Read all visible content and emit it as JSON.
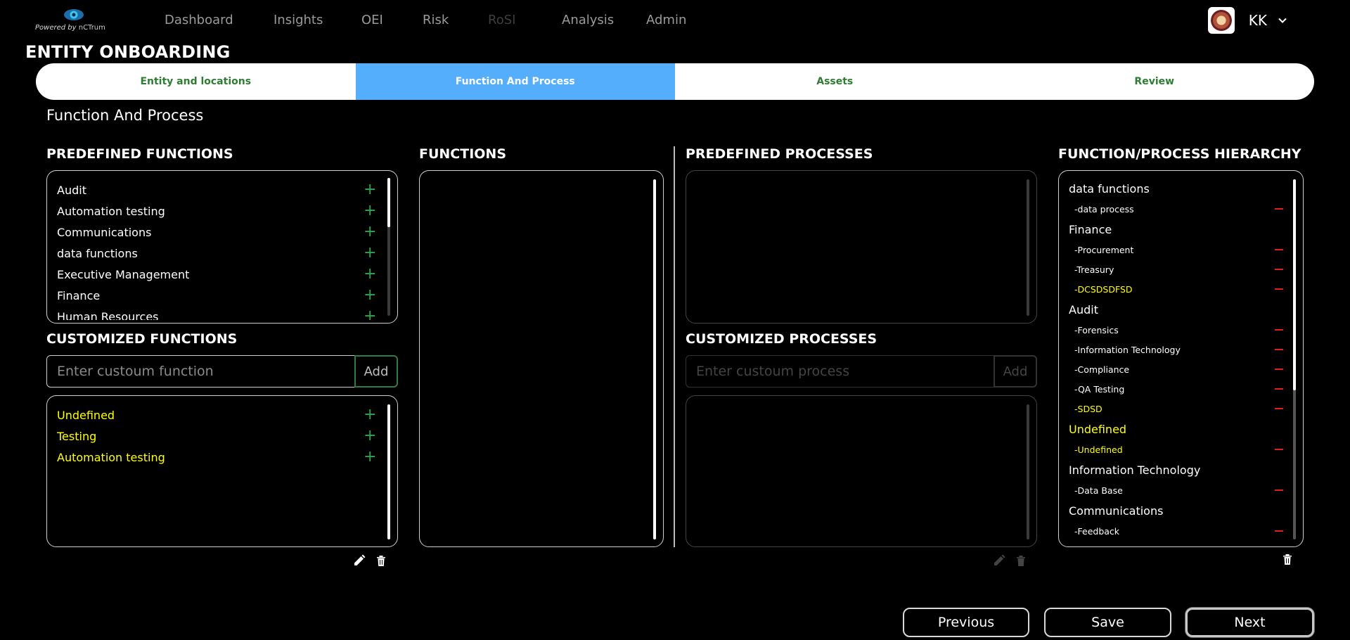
{
  "brand": {
    "powered_by": "Powered by",
    "product": "nCTrum"
  },
  "nav": {
    "items": [
      {
        "label": "Dashboard"
      },
      {
        "label": "Insights"
      },
      {
        "label": "OEI"
      },
      {
        "label": "Risk"
      },
      {
        "label": "RoSI"
      },
      {
        "label": "Analysis"
      },
      {
        "label": "Admin"
      }
    ]
  },
  "user": {
    "initials": "KK"
  },
  "page": {
    "title": "ENTITY ONBOARDING",
    "section_title": "Function And Process"
  },
  "stepper": {
    "steps": [
      {
        "label": "Entity and locations"
      },
      {
        "label": "Function And Process"
      },
      {
        "label": "Assets"
      },
      {
        "label": "Review"
      }
    ],
    "active_index": 1
  },
  "predefined_functions": {
    "title": "PREDEFINED FUNCTIONS",
    "items": [
      "Audit",
      "Automation testing",
      "Communications",
      "data functions",
      "Executive Management",
      "Finance",
      "Human Resources"
    ]
  },
  "customized_functions": {
    "title": "CUSTOMIZED FUNCTIONS",
    "placeholder": "Enter custoum function",
    "add_label": "Add",
    "items": [
      "Undefined",
      "Testing",
      "Automation testing"
    ]
  },
  "functions": {
    "title": "FUNCTIONS"
  },
  "predefined_processes": {
    "title": "PREDEFINED PROCESSES"
  },
  "customized_processes": {
    "title": "CUSTOMIZED PROCESSES",
    "placeholder": "Enter custoum process",
    "add_label": "Add"
  },
  "hierarchy": {
    "title": "FUNCTION/PROCESS HIERARCHY",
    "groups": [
      {
        "name": "data functions",
        "processes": [
          "-data process"
        ]
      },
      {
        "name": "Finance",
        "processes": [
          "-Procurement",
          "-Treasury",
          "-DCSDSDFSD"
        ]
      },
      {
        "name": "Audit",
        "processes": [
          "-Forensics",
          "-Information Technology",
          "-Compliance",
          "-QA Testing",
          "-SDSD"
        ]
      },
      {
        "name": "Undefined",
        "processes": [
          "-Undefined"
        ]
      },
      {
        "name": "Information Technology",
        "processes": [
          "-Data Base"
        ]
      },
      {
        "name": "Communications",
        "processes": [
          "-Feedback"
        ]
      }
    ]
  },
  "footer": {
    "previous_label": "Previous",
    "save_label": "Save",
    "next_label": "Next"
  },
  "colors": {
    "accent_blue": "#55aefb",
    "step_green": "#2e7d32",
    "add_green": "#2ca84b",
    "custom_yellow": "#ffff00",
    "remove_red": "#e02020"
  }
}
